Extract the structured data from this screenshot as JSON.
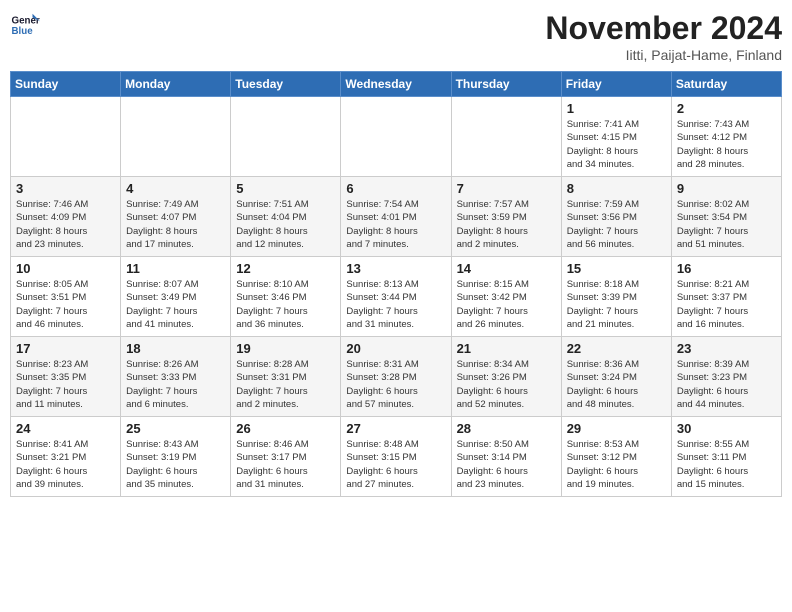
{
  "logo": {
    "line1": "General",
    "line2": "Blue"
  },
  "title": "November 2024",
  "subtitle": "Iitti, Paijat-Hame, Finland",
  "days_of_week": [
    "Sunday",
    "Monday",
    "Tuesday",
    "Wednesday",
    "Thursday",
    "Friday",
    "Saturday"
  ],
  "weeks": [
    [
      {
        "day": "",
        "info": ""
      },
      {
        "day": "",
        "info": ""
      },
      {
        "day": "",
        "info": ""
      },
      {
        "day": "",
        "info": ""
      },
      {
        "day": "",
        "info": ""
      },
      {
        "day": "1",
        "info": "Sunrise: 7:41 AM\nSunset: 4:15 PM\nDaylight: 8 hours\nand 34 minutes."
      },
      {
        "day": "2",
        "info": "Sunrise: 7:43 AM\nSunset: 4:12 PM\nDaylight: 8 hours\nand 28 minutes."
      }
    ],
    [
      {
        "day": "3",
        "info": "Sunrise: 7:46 AM\nSunset: 4:09 PM\nDaylight: 8 hours\nand 23 minutes."
      },
      {
        "day": "4",
        "info": "Sunrise: 7:49 AM\nSunset: 4:07 PM\nDaylight: 8 hours\nand 17 minutes."
      },
      {
        "day": "5",
        "info": "Sunrise: 7:51 AM\nSunset: 4:04 PM\nDaylight: 8 hours\nand 12 minutes."
      },
      {
        "day": "6",
        "info": "Sunrise: 7:54 AM\nSunset: 4:01 PM\nDaylight: 8 hours\nand 7 minutes."
      },
      {
        "day": "7",
        "info": "Sunrise: 7:57 AM\nSunset: 3:59 PM\nDaylight: 8 hours\nand 2 minutes."
      },
      {
        "day": "8",
        "info": "Sunrise: 7:59 AM\nSunset: 3:56 PM\nDaylight: 7 hours\nand 56 minutes."
      },
      {
        "day": "9",
        "info": "Sunrise: 8:02 AM\nSunset: 3:54 PM\nDaylight: 7 hours\nand 51 minutes."
      }
    ],
    [
      {
        "day": "10",
        "info": "Sunrise: 8:05 AM\nSunset: 3:51 PM\nDaylight: 7 hours\nand 46 minutes."
      },
      {
        "day": "11",
        "info": "Sunrise: 8:07 AM\nSunset: 3:49 PM\nDaylight: 7 hours\nand 41 minutes."
      },
      {
        "day": "12",
        "info": "Sunrise: 8:10 AM\nSunset: 3:46 PM\nDaylight: 7 hours\nand 36 minutes."
      },
      {
        "day": "13",
        "info": "Sunrise: 8:13 AM\nSunset: 3:44 PM\nDaylight: 7 hours\nand 31 minutes."
      },
      {
        "day": "14",
        "info": "Sunrise: 8:15 AM\nSunset: 3:42 PM\nDaylight: 7 hours\nand 26 minutes."
      },
      {
        "day": "15",
        "info": "Sunrise: 8:18 AM\nSunset: 3:39 PM\nDaylight: 7 hours\nand 21 minutes."
      },
      {
        "day": "16",
        "info": "Sunrise: 8:21 AM\nSunset: 3:37 PM\nDaylight: 7 hours\nand 16 minutes."
      }
    ],
    [
      {
        "day": "17",
        "info": "Sunrise: 8:23 AM\nSunset: 3:35 PM\nDaylight: 7 hours\nand 11 minutes."
      },
      {
        "day": "18",
        "info": "Sunrise: 8:26 AM\nSunset: 3:33 PM\nDaylight: 7 hours\nand 6 minutes."
      },
      {
        "day": "19",
        "info": "Sunrise: 8:28 AM\nSunset: 3:31 PM\nDaylight: 7 hours\nand 2 minutes."
      },
      {
        "day": "20",
        "info": "Sunrise: 8:31 AM\nSunset: 3:28 PM\nDaylight: 6 hours\nand 57 minutes."
      },
      {
        "day": "21",
        "info": "Sunrise: 8:34 AM\nSunset: 3:26 PM\nDaylight: 6 hours\nand 52 minutes."
      },
      {
        "day": "22",
        "info": "Sunrise: 8:36 AM\nSunset: 3:24 PM\nDaylight: 6 hours\nand 48 minutes."
      },
      {
        "day": "23",
        "info": "Sunrise: 8:39 AM\nSunset: 3:23 PM\nDaylight: 6 hours\nand 44 minutes."
      }
    ],
    [
      {
        "day": "24",
        "info": "Sunrise: 8:41 AM\nSunset: 3:21 PM\nDaylight: 6 hours\nand 39 minutes."
      },
      {
        "day": "25",
        "info": "Sunrise: 8:43 AM\nSunset: 3:19 PM\nDaylight: 6 hours\nand 35 minutes."
      },
      {
        "day": "26",
        "info": "Sunrise: 8:46 AM\nSunset: 3:17 PM\nDaylight: 6 hours\nand 31 minutes."
      },
      {
        "day": "27",
        "info": "Sunrise: 8:48 AM\nSunset: 3:15 PM\nDaylight: 6 hours\nand 27 minutes."
      },
      {
        "day": "28",
        "info": "Sunrise: 8:50 AM\nSunset: 3:14 PM\nDaylight: 6 hours\nand 23 minutes."
      },
      {
        "day": "29",
        "info": "Sunrise: 8:53 AM\nSunset: 3:12 PM\nDaylight: 6 hours\nand 19 minutes."
      },
      {
        "day": "30",
        "info": "Sunrise: 8:55 AM\nSunset: 3:11 PM\nDaylight: 6 hours\nand 15 minutes."
      }
    ]
  ]
}
